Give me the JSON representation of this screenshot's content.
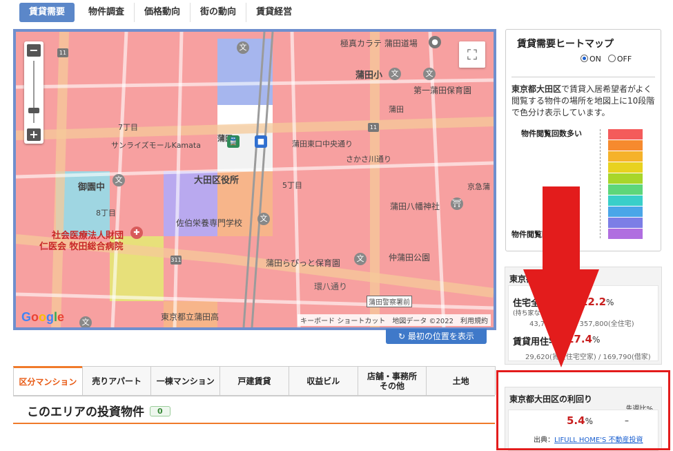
{
  "top_tabs": [
    {
      "label": "賃貸需要",
      "active": true
    },
    {
      "label": "物件調査"
    },
    {
      "label": "価格動向"
    },
    {
      "label": "街の動向"
    },
    {
      "label": "賃貸経営"
    }
  ],
  "map": {
    "labels": {
      "karate": "極真カラテ 蒲田道場",
      "kamata_sho": "蒲田小",
      "hoikuen1": "第一蒲田保育園",
      "kamata": "蒲田",
      "nanachome": "7丁目",
      "sunrise": "サンライズモールKamata",
      "eki": "蒲田",
      "higashiguchi": "蒲田東口中央通り",
      "sakasa": "さかさ川通り",
      "kuyakusho": "大田区役所",
      "gochome": "5丁目",
      "mikuni": "御園中",
      "hachichome": "8丁目",
      "hachiman": "蒲田八幡神社",
      "sakuhei": "佐伯栄養専門学校",
      "iryo1": "社会医療法人財団",
      "iryo2": "仁医会 牧田総合病院",
      "nakakamata": "仲蒲田公園",
      "piyotto": "蒲田らぴっと保育園",
      "kanpachi": "環八通り",
      "keisatsu": "蒲田警察署前",
      "kokou": "東京都立蒲田高",
      "keikyu": "京急蒲",
      "route11": "11",
      "route311": "311"
    },
    "fullscreen_icon": "fullscreen-icon",
    "zoom_in": "+",
    "zoom_out": "−",
    "google": "Google",
    "attribution": {
      "keyboard": "キーボード ショートカット",
      "mapdata": "地図データ ©2022",
      "terms": "利用規約"
    },
    "reset_button": "最初の位置を表示"
  },
  "heatmap": {
    "title": "賃貸需要ヒートマップ",
    "on_label": "ON",
    "off_label": "OFF",
    "selected": "ON",
    "description_area": "東京都大田区",
    "description_rest": "で賃貸入居希望者がよく閲覧する物件の場所を地図上に10段階で色分け表示しています。",
    "legend_high": "物件閲覧回数多い",
    "legend_low": "物件閲覧回数少ない",
    "colors": [
      "#f45b5b",
      "#f68a2e",
      "#f5b22a",
      "#e8d21f",
      "#a8d62a",
      "#5ed67a",
      "#39cfc9",
      "#4aa6e8",
      "#7c7ee6",
      "#b06ee0"
    ]
  },
  "vacancy": {
    "title": "東京都大田区の空室率",
    "residential_label": "住宅全体",
    "residential_note": "(持ち家など含む)",
    "residential_pct": "12.2",
    "residential_detail": "43,700(空室) / 357,800(全住宅)",
    "rental_label": "賃貸用住宅",
    "rental_pct": "17.4",
    "rental_detail": "29,620(賃貸住宅空家) / 169,790(借家)",
    "pct_unit": "%"
  },
  "yield": {
    "title": "東京都大田区の利回り",
    "prev_label": "先週比%",
    "value": "5.4",
    "unit": "%",
    "prev_value": "–",
    "source_label": "出典：",
    "source_link": "LIFULL HOME'S 不動産投資"
  },
  "bottom_tabs": [
    {
      "label": "区分マンション",
      "active": true
    },
    {
      "label": "売りアパート"
    },
    {
      "label": "一棟マンション"
    },
    {
      "label": "戸建賃貸"
    },
    {
      "label": "収益ビル"
    },
    {
      "label": "店舗・事務所\nその他"
    },
    {
      "label": "土地"
    }
  ],
  "section": {
    "title": "このエリアの投資物件",
    "count": "0"
  }
}
